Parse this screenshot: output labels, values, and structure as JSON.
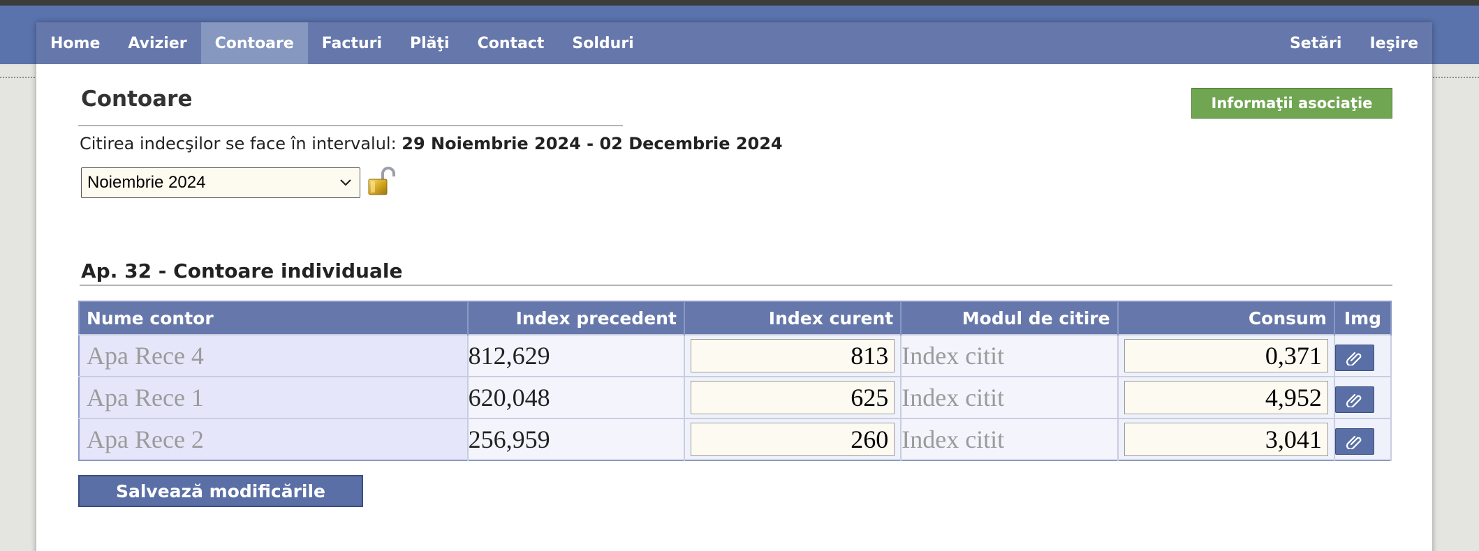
{
  "nav": {
    "left": [
      "Home",
      "Avizier",
      "Contoare",
      "Facturi",
      "Plăţi",
      "Contact",
      "Solduri"
    ],
    "right": [
      "Setări",
      "Ieşire"
    ],
    "active": "Contoare"
  },
  "page": {
    "title": "Contoare",
    "info_button": "Informaţii asociaţie",
    "interval_prefix": "Citirea indecşilor se face în intervalul: ",
    "interval_range": "29 Noiembrie 2024 - 02 Decembrie 2024",
    "period_select": "Noiembrie 2024",
    "lock_icon": "unlocked-padlock-icon"
  },
  "section": {
    "title": "Ap. 32 - Contoare individuale"
  },
  "table": {
    "headers": [
      "Nume contor",
      "Index precedent",
      "Index curent",
      "Modul de citire",
      "Consum",
      "Img"
    ],
    "rows": [
      {
        "name": "Apa Rece 4",
        "prev": "812,629",
        "cur": "813",
        "mode": "Index citit",
        "cons": "0,371"
      },
      {
        "name": "Apa Rece 1",
        "prev": "620,048",
        "cur": "625",
        "mode": "Index citit",
        "cons": "4,952"
      },
      {
        "name": "Apa Rece 2",
        "prev": "256,959",
        "cur": "260",
        "mode": "Index citit",
        "cons": "3,041"
      }
    ],
    "attach_icon": "paperclip-icon"
  },
  "actions": {
    "save": "Salvează modificările"
  },
  "colors": {
    "nav": "#6678ab",
    "nav_active": "#8697c0",
    "info_button": "#70a552",
    "save_button": "#5a6fa6"
  }
}
